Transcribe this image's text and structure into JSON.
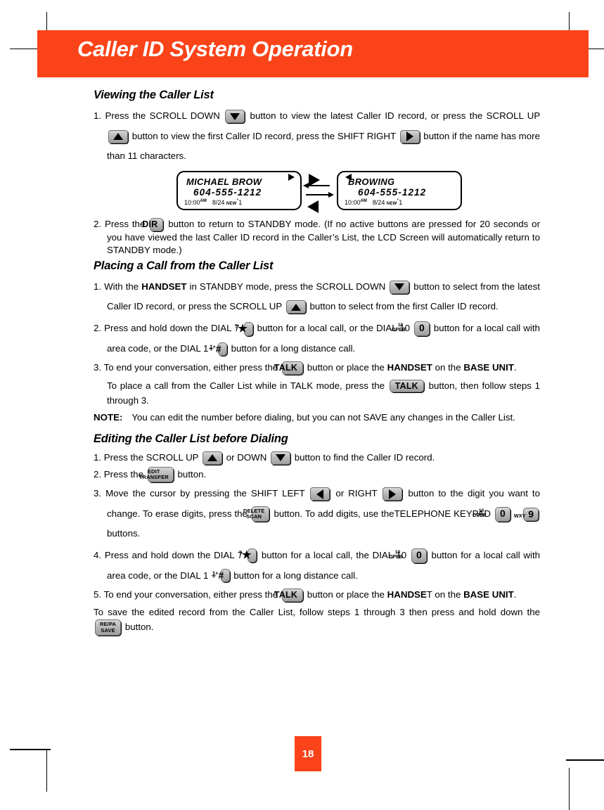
{
  "page": {
    "banner_title": "Caller ID System Operation",
    "page_number": "18",
    "accent_color": "#fa4318"
  },
  "sections": {
    "viewing": {
      "heading": "Viewing the Caller List",
      "step1": {
        "num": "1.",
        "a": "Press the SCROLL DOWN",
        "b": "button to view the latest Caller ID record, or press the",
        "c": "SCROLL UP",
        "d": "button to view the first Caller ID record, press the SHIFT RIGHT",
        "e": "button if the name has more than 11 characters."
      },
      "step2": {
        "num": "2.",
        "a": "Press the",
        "b": "button to return to STANDBY mode. (If no active buttons are pressed for 20 seconds or you have viewed the last Caller ID record in the Caller’s List, the LCD Screen will automatically return to STANDBY mode.)"
      }
    },
    "lcd": {
      "left": {
        "name": "MICHAEL BROW",
        "number": "604-555-1212",
        "time": "10:00",
        "ampm": "AM",
        "date": "8/24",
        "new_label": "NEW",
        "asterisk": "*",
        "count": "1"
      },
      "right": {
        "name": "BROWING",
        "number": "604-555-1212",
        "time": "10:00",
        "ampm": "AM",
        "date": "8/24",
        "new_label": "NEW",
        "asterisk": "*",
        "count": "1"
      }
    },
    "placing": {
      "heading": "Placing a Call from the Caller List",
      "step1": {
        "num": "1.",
        "a": "With the",
        "handset": "HANDSET",
        "b": "in STANDBY mode, press the SCROLL DOWN",
        "c": "button to select from the latest Caller ID record, or press the SCROLL UP",
        "d": "button to select from the first Caller ID record."
      },
      "step2": {
        "num": "2.",
        "a": "Press and hold down the DIAL 7",
        "b": "button for a local call, or the DIAL 10",
        "c": "button for a local call with area code, or the DIAL 1+",
        "d": "button for a long distance call."
      },
      "step3": {
        "num": "3.",
        "a": "To end your conversation, either press the",
        "b": "button or place the",
        "handset": "HANDSET",
        "c": "on the",
        "base": "BASE UNIT",
        "period": "."
      },
      "talkmode": {
        "a": "To place a call from the Caller List while in TALK mode, press the",
        "b": "button, then follow steps 1 through 3."
      },
      "note": {
        "label": "NOTE",
        "colon": ":",
        "body": "You can edit the number before dialing, but you can not SAVE any changes in the Caller List."
      }
    },
    "editing": {
      "heading": "Editing the Caller List before Dialing",
      "step1": {
        "num": "1.",
        "a": "Press the SCROLL UP",
        "b": "or DOWN",
        "c": "button to find the Caller ID record."
      },
      "step2": {
        "num": "2.",
        "a": "Press the",
        "b": "button."
      },
      "step3": {
        "num": "3.",
        "a": "Move the cursor by pressing the SHIFT LEFT",
        "b": "or RIGHT",
        "c": "button to the digit you want to change. To erase digits, press the",
        "d": "button. To add digits, use",
        "e": "theTELEPHONE KEYPAD",
        "tilde": "~",
        "f": "buttons."
      },
      "step4": {
        "num": "4.",
        "a": "Press and hold down the DIAL 7",
        "b": "button for a local call, the DIAL 10",
        "c": "button for a local call with area code, or the DIAL 1 +",
        "d": "button for a long distance call."
      },
      "step5": {
        "num": "5.",
        "a": "To end your conversation, either press the",
        "b": "button or place the",
        "handset": "HANDSE",
        "handset_tail": "T",
        "c": "on the",
        "base": "BASE UNIT",
        "period": "."
      },
      "save": {
        "a": "To save the edited record from the Caller List, follow steps 1 through 3 then press and hold down the",
        "b": "button."
      }
    }
  },
  "keys": {
    "scroll_down": "scroll-down-arrow",
    "scroll_up": "scroll-up-arrow",
    "shift_right": "shift-right-arrow",
    "shift_left": "shift-left-arrow",
    "dir": "DIR",
    "talk": "TALK",
    "edit_line1": "EDIT",
    "edit_line2": "TRANSFER",
    "delete_line1": "DELETE",
    "delete_line2": "SCAN",
    "repa_line1": "RE/PA",
    "repa_line2": "SAVE",
    "dial7_sup": "7",
    "dial7_star": "★",
    "dial10_sup": "10",
    "dial10_oper": "OPER",
    "dial10_digit": "0",
    "dial1_sup": "1+",
    "dial1_hash": "#",
    "wxy_label": "WXY",
    "wxy_digit": "9"
  }
}
